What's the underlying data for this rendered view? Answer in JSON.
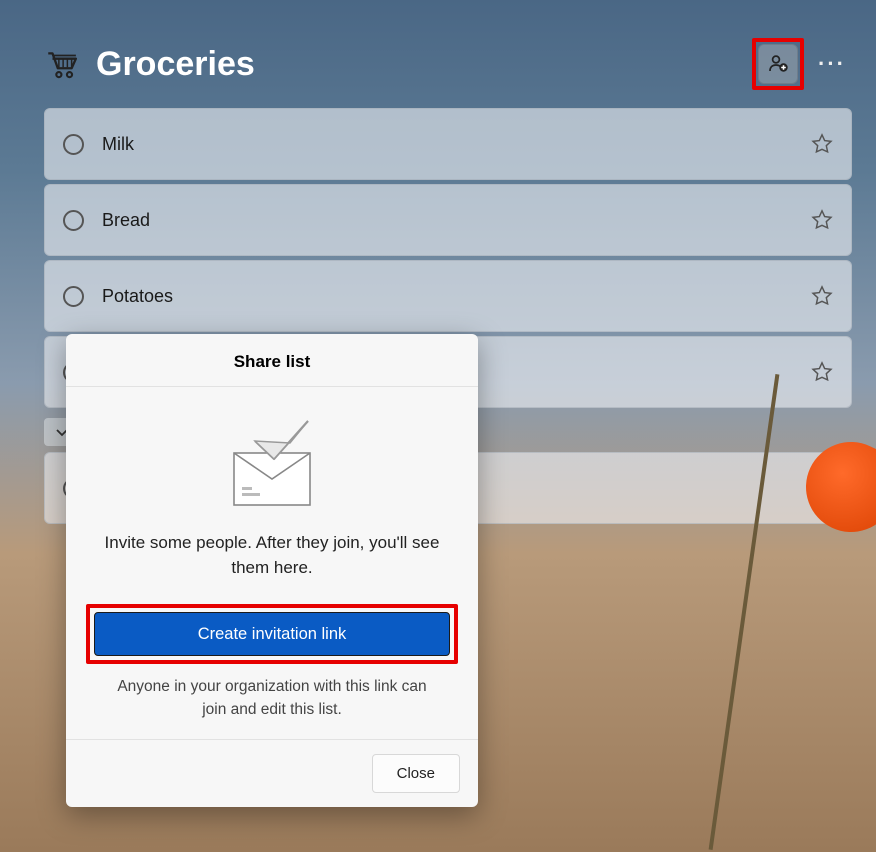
{
  "header": {
    "title": "Groceries"
  },
  "tasks": [
    {
      "label": "Milk"
    },
    {
      "label": "Bread"
    },
    {
      "label": "Potatoes"
    },
    {
      "label": ""
    },
    {
      "label": ""
    }
  ],
  "dialog": {
    "title": "Share list",
    "inviteText": "Invite some people. After they join, you'll see them here.",
    "ctaLabel": "Create invitation link",
    "subtext": "Anyone in your organization with this link can join and edit this list.",
    "closeLabel": "Close"
  }
}
